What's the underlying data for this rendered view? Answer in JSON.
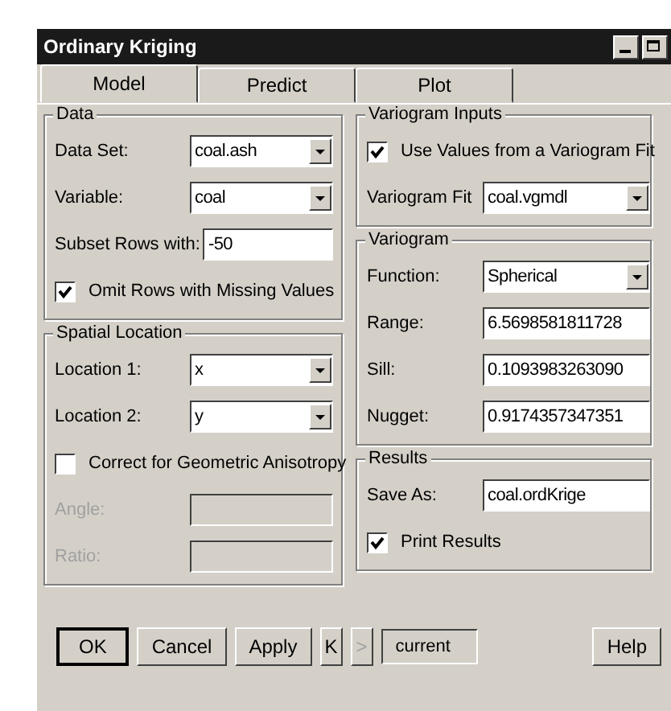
{
  "window": {
    "title": "Ordinary Kriging"
  },
  "tabs": [
    {
      "label": "Model",
      "selected": true
    },
    {
      "label": "Predict",
      "selected": false
    },
    {
      "label": "Plot",
      "selected": false
    }
  ],
  "data": {
    "title": "Data",
    "fields": [
      {
        "kind": "select",
        "label": "Data Set:",
        "value": "coal.ash",
        "disabled": false
      },
      {
        "kind": "select",
        "label": "Variable:",
        "value": "coal",
        "disabled": false
      },
      {
        "kind": "text",
        "label": "Subset Rows with:",
        "value": "-50",
        "disabled": false
      }
    ],
    "checkbox": {
      "label": "Omit Rows with Missing Values",
      "checked": true
    }
  },
  "spatial": {
    "title": "Spatial Location",
    "fields": [
      {
        "kind": "select",
        "label": "Location 1:",
        "value": "x",
        "disabled": false
      },
      {
        "kind": "select",
        "label": "Location 2:",
        "value": "y",
        "disabled": false
      }
    ],
    "checkbox": {
      "label": "Correct for Geometric Anisotropy",
      "checked": false
    },
    "fields2": [
      {
        "label": "Angle:",
        "disabled": true
      },
      {
        "label": "Ratio:",
        "disabled": true
      }
    ]
  },
  "variogram_inputs": {
    "title": "Variogram Inputs",
    "checkbox": {
      "label": "Use Values from a Variogram Fit",
      "checked": true
    },
    "fields": [
      {
        "kind": "select",
        "label": "Variogram Fit",
        "value": "coal.vgmdl",
        "disabled": false
      }
    ]
  },
  "variogram": {
    "title": "Variogram",
    "fields": [
      {
        "kind": "select",
        "label": "Function:",
        "value": "Spherical",
        "disabled": false
      },
      {
        "kind": "text",
        "label": "Range:",
        "value": "6.5698581811728",
        "disabled": false
      },
      {
        "kind": "text",
        "label": "Sill:",
        "value": "0.1093983263090",
        "disabled": false
      },
      {
        "kind": "text",
        "label": "Nugget:",
        "value": "0.9174357347351",
        "disabled": false
      }
    ]
  },
  "results": {
    "title": "Results",
    "fields": [
      {
        "kind": "text",
        "label": "Save As:",
        "value": "coal.ordKrige",
        "disabled": false
      }
    ],
    "checkbox": {
      "label": "Print Results",
      "checked": true
    }
  },
  "buttons": [
    {
      "label": "OK",
      "kind": "button",
      "disabled": false
    },
    {
      "label": "Cancel",
      "kind": "button",
      "disabled": false
    },
    {
      "label": "Apply",
      "kind": "button",
      "disabled": false
    },
    {
      "label": "K",
      "kind": "nav",
      "disabled": false
    },
    {
      "label": ">",
      "kind": "nav",
      "disabled": true
    },
    {
      "label": "current",
      "kind": "field"
    },
    {
      "label": "Help",
      "kind": "button",
      "disabled": false
    }
  ]
}
